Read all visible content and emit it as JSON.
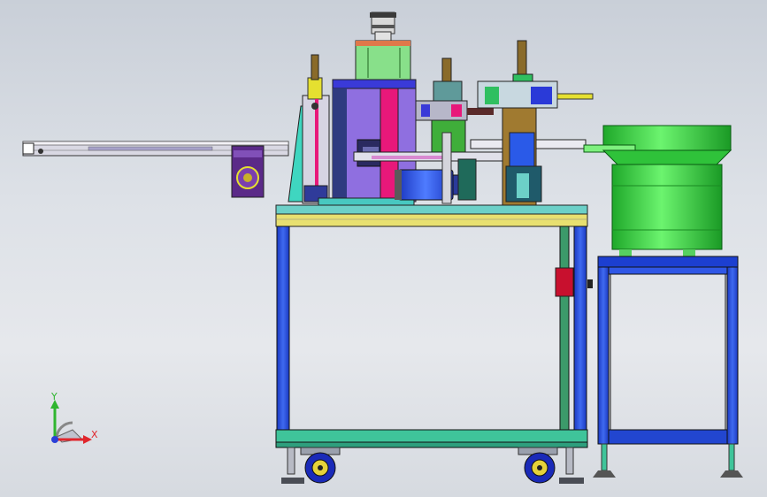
{
  "viewport": {
    "background": "#dfe3e9",
    "description_icon": "cad-3d-model-view"
  },
  "triad": {
    "x_label": "X",
    "y_label": "Y",
    "x_color": "#e0262c",
    "y_color": "#2fb52f",
    "z_color": "#2a3fd8"
  },
  "colors": {
    "frame_blue": "#2a4fd6",
    "table_top": "#e8e070",
    "bowl_green": "#3ee04a",
    "stand_blue": "#1c3fd0",
    "base_green": "#3fc49a",
    "column_purple": "#8f6fe0",
    "magenta_plate": "#e8187a",
    "rail_gray": "#d5d5dc",
    "motor_purple": "#6a2a9a",
    "red_box": "#c8102e",
    "cylinder_blue": "#2a5ae8",
    "caster_blue": "#1a2ab8"
  }
}
